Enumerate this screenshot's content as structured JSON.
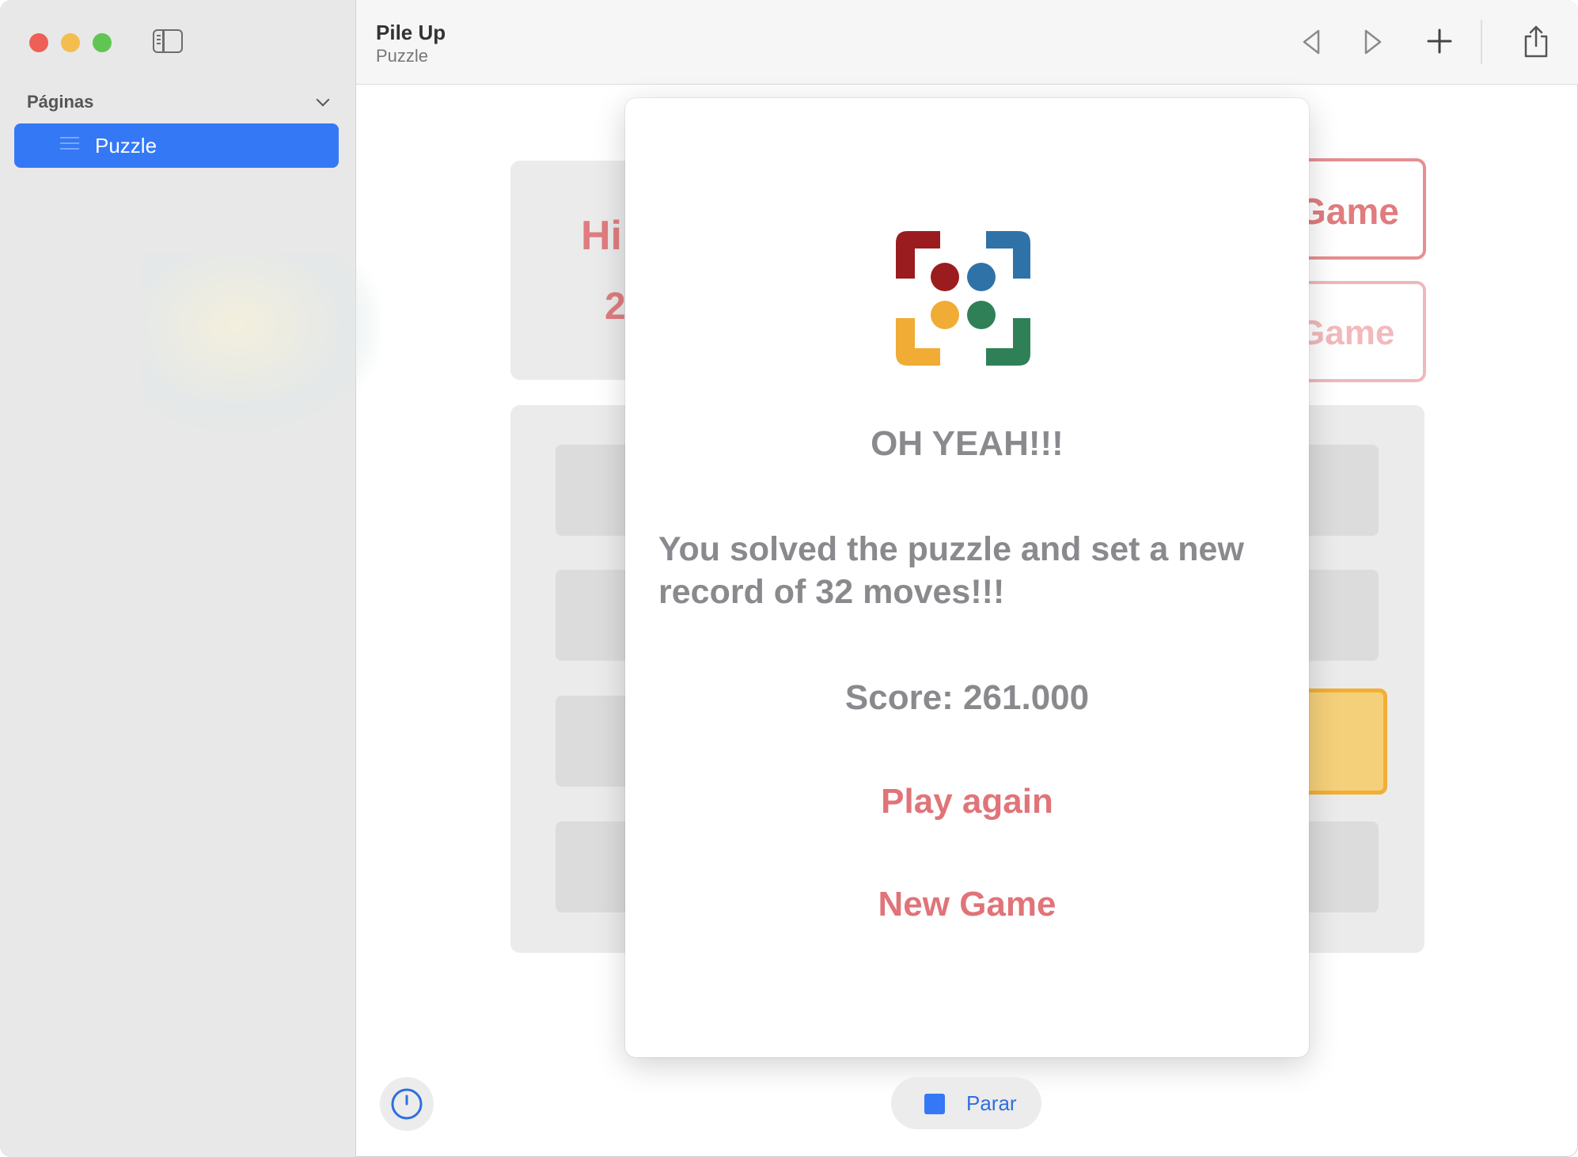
{
  "app": {
    "title": "Pile Up",
    "subtitle": "Puzzle"
  },
  "sidebar": {
    "section_title": "Páginas",
    "items": [
      {
        "label": "Puzzle",
        "selected": true
      }
    ]
  },
  "toolbar": {
    "icons": [
      "back-triangle-icon",
      "forward-triangle-icon",
      "plus-icon",
      "share-icon"
    ]
  },
  "background_game": {
    "stat_label_partial": "Hi",
    "stat_value_partial": "2",
    "button1_partial": "Game",
    "button2_partial": "Game"
  },
  "modal": {
    "heading": "OH YEAH!!!",
    "message": "You solved the puzzle and set a new record of 32 moves!!!",
    "score": "Score: 261.000",
    "play_again_label": "Play again",
    "new_game_label": "New Game",
    "logo_colors": {
      "red": "#9b1c1f",
      "blue": "#2f72a8",
      "yellow": "#f0ac35",
      "green": "#2f8057"
    }
  },
  "bottom": {
    "stop_label": "Parar"
  },
  "colors": {
    "accent": "#3478f6",
    "modal_button": "#e07479",
    "modal_text": "#8a8a8e"
  }
}
